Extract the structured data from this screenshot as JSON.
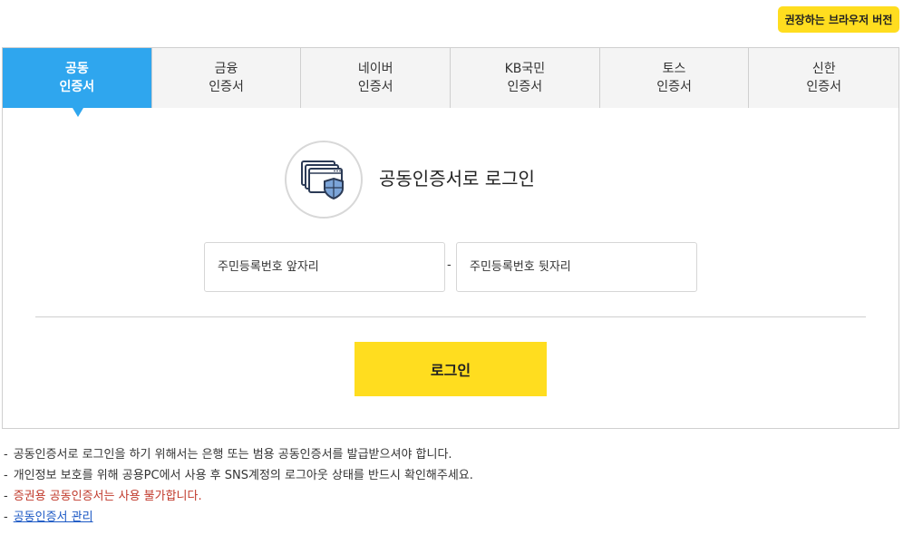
{
  "header": {
    "browser_button_label": "권장하는 브라우저 버전"
  },
  "tabs": [
    {
      "line1": "공동",
      "line2": "인증서",
      "active": true
    },
    {
      "line1": "금융",
      "line2": "인증서",
      "active": false
    },
    {
      "line1": "네이버",
      "line2": "인증서",
      "active": false
    },
    {
      "line1": "KB국민",
      "line2": "인증서",
      "active": false
    },
    {
      "line1": "토스",
      "line2": "인증서",
      "active": false
    },
    {
      "line1": "신한",
      "line2": "인증서",
      "active": false
    }
  ],
  "login": {
    "icon": "certificate-shield-icon",
    "title": "공동인증서로 로그인",
    "rrn_front_placeholder": "주민등록번호 앞자리",
    "rrn_back_placeholder": "주민등록번호 뒷자리",
    "separator": "-",
    "button_label": "로그인"
  },
  "notices": {
    "dash": "-",
    "items": [
      "공동인증서로 로그인을 하기 위해서는 은행 또는 범용 공동인증서를 발급받으셔야 합니다.",
      "개인정보 보호를 위해 공용PC에서 사용 후 SNS계정의 로그아웃 상태를 반드시 확인해주세요.",
      "증권용 공동인증서는 사용 불가합니다.",
      "공동인증서 관리"
    ]
  },
  "colors": {
    "accent_yellow": "#ffdd1f",
    "active_tab_blue": "#2fa6ee",
    "warning_red": "#c0392b",
    "link_blue": "#1a57c4"
  }
}
